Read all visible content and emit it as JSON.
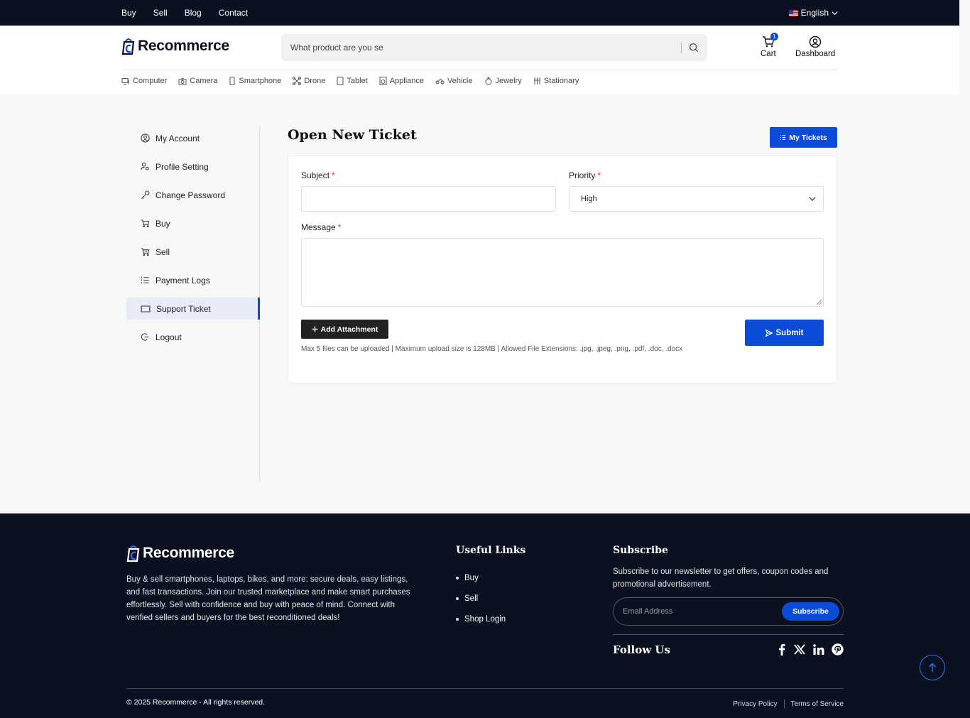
{
  "topbar": {
    "nav": [
      "Buy",
      "Sell",
      "Blog",
      "Contact"
    ],
    "language": "English"
  },
  "header": {
    "logo_text": "Recommerce",
    "search_placeholder": "What product are you se",
    "cart_label": "Cart",
    "cart_count": "1",
    "dashboard_label": "Dashboard"
  },
  "categories": [
    {
      "label": "Computer",
      "icon": "computer-icon"
    },
    {
      "label": "Camera",
      "icon": "camera-icon"
    },
    {
      "label": "Smartphone",
      "icon": "smartphone-icon"
    },
    {
      "label": "Drone",
      "icon": "drone-icon"
    },
    {
      "label": "Tablet",
      "icon": "tablet-icon"
    },
    {
      "label": "Appliance",
      "icon": "appliance-icon"
    },
    {
      "label": "Vehicle",
      "icon": "vehicle-icon"
    },
    {
      "label": "Jewelry",
      "icon": "jewelry-icon"
    },
    {
      "label": "Stationary",
      "icon": "stationary-icon"
    }
  ],
  "sidebar": {
    "items": [
      {
        "label": "My Account",
        "icon": "user-circle-icon"
      },
      {
        "label": "Profile Setting",
        "icon": "user-gear-icon"
      },
      {
        "label": "Change Password",
        "icon": "key-icon"
      },
      {
        "label": "Buy",
        "icon": "cart-icon"
      },
      {
        "label": "Sell",
        "icon": "sell-cart-icon"
      },
      {
        "label": "Payment Logs",
        "icon": "list-icon"
      },
      {
        "label": "Support Ticket",
        "icon": "ticket-icon",
        "active": true
      },
      {
        "label": "Logout",
        "icon": "logout-icon"
      }
    ]
  },
  "main": {
    "title": "Open New Ticket",
    "my_tickets_label": "My Tickets",
    "form": {
      "subject_label": "Subject",
      "priority_label": "Priority",
      "priority_value": "High",
      "message_label": "Message",
      "required_mark": "*",
      "add_attachment_label": "Add Attachment",
      "upload_hint": "Max 5 files can be uploaded | Maximum upload size is 128MB | Allowed File Extensions: .jpg, .jpeg, .png, .pdf, .doc, .docx",
      "submit_label": "Submit"
    }
  },
  "footer": {
    "logo_text": "Recommerce",
    "description": "Buy & sell smartphones, laptops, bikes, and more: secure deals, easy listings, and fast transactions. Join our trusted marketplace and make smart purchases effortlessly. Sell with confidence and buy with peace of mind. Connect with verified sellers and buyers for the best reconditioned deals!",
    "useful_links_title": "Useful Links",
    "useful_links": [
      "Buy",
      "Sell",
      "Shop Login"
    ],
    "subscribe_title": "Subscribe",
    "subscribe_text": "Subscribe to our newsletter to get offers, coupon codes and promotional advertisement.",
    "email_placeholder": "Email Address",
    "subscribe_button": "Subscribe",
    "follow_title": "Follow Us",
    "social": [
      "facebook-icon",
      "x-icon",
      "linkedin-icon",
      "pinterest-icon"
    ],
    "copyright": "© 2025 Recommerce - All rights reserved.",
    "privacy_label": "Privacy Policy",
    "terms_label": "Terms of Service"
  },
  "colors": {
    "accent": "#0b4cd6",
    "dark_bg": "#0b1120",
    "page_bg": "#f7f7f7"
  }
}
